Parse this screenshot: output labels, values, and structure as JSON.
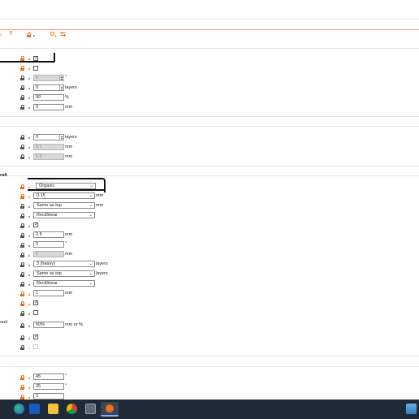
{
  "toolbar": {
    "left_glyph": "‹",
    "help_label": "?"
  },
  "rows_a": {
    "spin_0": "0",
    "degree_unit": "°",
    "layers_value": "0",
    "layers_unit": "layers",
    "percent_value": "90",
    "percent_unit": "%",
    "mm_value": "3",
    "mm_unit": "mm"
  },
  "rows_b": {
    "layers_value": "0",
    "layers_unit": "layers",
    "first_disabled": "0.1",
    "second_disabled": "1.5",
    "mm_unit": "mm"
  },
  "raft_section": {
    "partial_label": "raft",
    "style_select": "Organic",
    "gap_select": "0.15",
    "gap_unit": "mm",
    "bottom_select": "Same as top",
    "bottom_unit": "mm",
    "pattern_select": "Rectilinear",
    "spacing_value": "2.5",
    "spacing_unit": "mm",
    "angle_value": "0",
    "angle_unit": "°",
    "disabled_value": "2",
    "disabled_unit": "mm",
    "layers_select": "3 (heavy)",
    "layers_unit": "layers",
    "bottom_layers_select": "Same as top",
    "bottom_layers_unit": "layers",
    "pattern2_select": "Rectilinear",
    "dist_value": "1",
    "dist_unit": "mm",
    "and_label": "and",
    "percent_value": "50%",
    "percent_unit": "mm or %"
  },
  "bottom_section": {
    "angle1": "45",
    "angle2": "25",
    "angle3": "2",
    "deg": "°"
  },
  "colors": {
    "accent": "#e8711f",
    "taskbar": "#1f2a38"
  }
}
